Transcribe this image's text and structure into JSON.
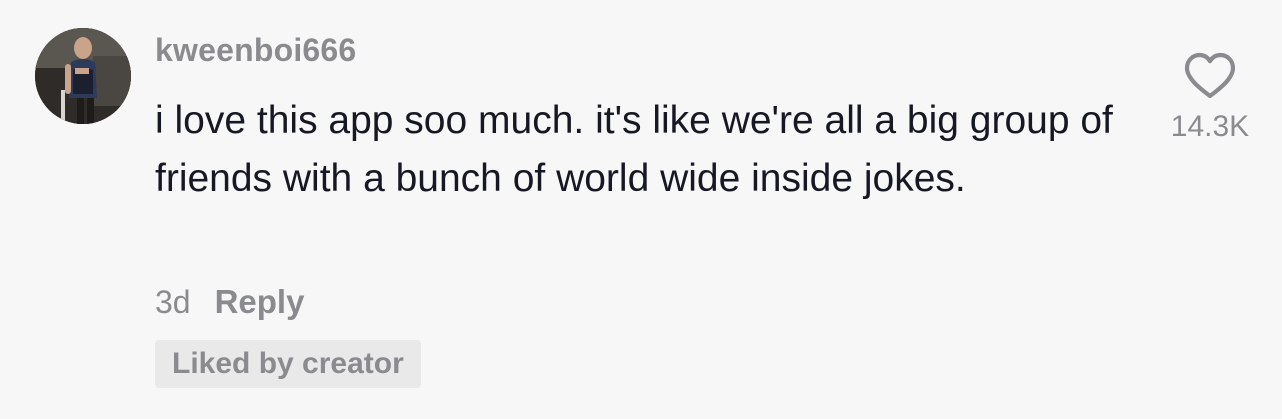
{
  "comment": {
    "username": "kweenboi666",
    "text": "i love this app soo much. it's like we're all a big group of friends with a bunch of world wide inside jokes.",
    "time": "3d",
    "reply_label": "Reply",
    "badge": "Liked by creator",
    "like_count": "14.3K",
    "like_icon": "heart-outline-icon"
  },
  "colors": {
    "background": "#f7f7f7",
    "text_primary": "#161823",
    "text_secondary": "#8a8b8f",
    "badge_bg": "#e9e9ea"
  }
}
